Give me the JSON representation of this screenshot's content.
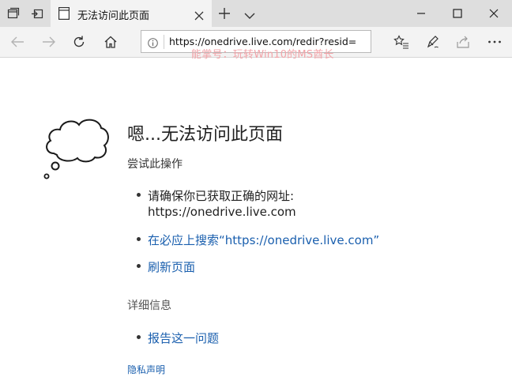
{
  "browser": {
    "tab": {
      "title": "无法访问此页面"
    },
    "address_bar": {
      "url": "https://onedrive.live.com/redir?resid="
    },
    "watermark": "能掌号：玩转Win10的MS酋长"
  },
  "error_page": {
    "title": "嗯...无法访问此页面",
    "try_label": "尝试此操作",
    "suggestions": {
      "check_address_line1": "请确保你已获取正确的网址:",
      "check_address_line2": "https://onedrive.live.com",
      "search_bing": "在必应上搜索“https://onedrive.live.com”",
      "refresh": "刷新页面"
    },
    "details_label": "详细信息",
    "report_problem": "报告这一问题",
    "privacy_statement": "隐私声明"
  },
  "colors": {
    "link": "#1a5fae",
    "watermark": "#f2a3a8",
    "tab_strip": "#dedede",
    "toolbar": "#f3f3f3"
  },
  "icons": [
    "tab-list-icon",
    "set-aside-tabs-icon",
    "page-icon",
    "tab-close-icon",
    "new-tab-icon",
    "tab-preview-chevron-icon",
    "minimize-icon",
    "maximize-icon",
    "window-close-icon",
    "back-arrow-icon",
    "forward-arrow-icon",
    "refresh-icon",
    "home-icon",
    "info-icon",
    "favorites-icon",
    "pen-icon",
    "share-icon",
    "more-icon",
    "thought-cloud-icon"
  ]
}
